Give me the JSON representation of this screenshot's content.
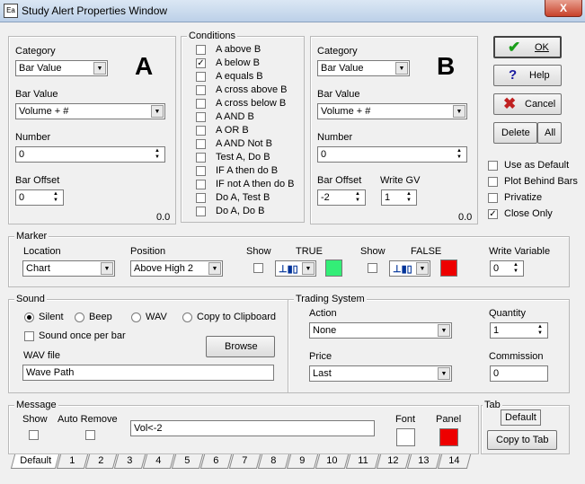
{
  "window": {
    "title": "Study Alert Properties Window",
    "close_label": "X"
  },
  "group_a": {
    "letter": "A",
    "category_label": "Category",
    "category_value": "Bar Value",
    "bar_value_label": "Bar Value",
    "bar_value_value": "Volume + #",
    "number_label": "Number",
    "number_value": "0",
    "bar_offset_label": "Bar Offset",
    "bar_offset_value": "0",
    "readout": "0.0"
  },
  "conditions": {
    "title": "Conditions",
    "items": [
      {
        "label": "A  above  B",
        "checked": false
      },
      {
        "label": "A  below  B",
        "checked": true
      },
      {
        "label": "A  equals  B",
        "checked": false
      },
      {
        "label": "A  cross above  B",
        "checked": false
      },
      {
        "label": "A  cross below  B",
        "checked": false
      },
      {
        "label": "A  AND  B",
        "checked": false
      },
      {
        "label": "A   OR   B",
        "checked": false
      },
      {
        "label": "A  AND Not  B",
        "checked": false
      },
      {
        "label": "Test A,  Do B",
        "checked": false
      },
      {
        "label": "IF A then do B",
        "checked": false
      },
      {
        "label": "IF not A then do B",
        "checked": false
      },
      {
        "label": "Do A,  Test B",
        "checked": false
      },
      {
        "label": "Do A,  Do B",
        "checked": false
      }
    ]
  },
  "group_b": {
    "letter": "B",
    "category_label": "Category",
    "category_value": "Bar Value",
    "bar_value_label": "Bar Value",
    "bar_value_value": "Volume + #",
    "number_label": "Number",
    "number_value": "0",
    "bar_offset_label": "Bar Offset",
    "bar_offset_value": "-2",
    "write_gv_label": "Write GV",
    "write_gv_value": "1",
    "readout": "0.0"
  },
  "buttons": {
    "ok": "OK",
    "help": "Help",
    "cancel": "Cancel",
    "delete": "Delete",
    "all": "All",
    "browse": "Browse",
    "copy_to_tab": "Copy to Tab",
    "default": "Default"
  },
  "options": [
    {
      "label": "Use as Default",
      "checked": false
    },
    {
      "label": "Plot Behind Bars",
      "checked": false
    },
    {
      "label": "Privatize",
      "checked": false
    },
    {
      "label": "Close Only",
      "checked": true
    }
  ],
  "marker": {
    "title": "Marker",
    "location_label": "Location",
    "location_value": "Chart",
    "position_label": "Position",
    "position_value": "Above High 2",
    "show_label_1": "Show",
    "true_label": "TRUE",
    "true_color": "#33ee77",
    "show_label_2": "Show",
    "false_label": "FALSE",
    "false_color": "#ee0000",
    "write_variable_label": "Write Variable",
    "write_variable_value": "0"
  },
  "sound": {
    "title": "Sound",
    "radios": [
      {
        "label": "Silent",
        "selected": true
      },
      {
        "label": "Beep",
        "selected": false
      },
      {
        "label": "WAV",
        "selected": false
      },
      {
        "label": "Copy to Clipboard",
        "selected": false
      }
    ],
    "once_label": "Sound once per bar",
    "wav_label": "WAV file",
    "wav_value": "Wave Path"
  },
  "trading": {
    "title": "Trading System",
    "action_label": "Action",
    "action_value": "None",
    "quantity_label": "Quantity",
    "quantity_value": "1",
    "price_label": "Price",
    "price_value": "Last",
    "commission_label": "Commission",
    "commission_value": "0"
  },
  "message": {
    "title": "Message",
    "show_label": "Show",
    "auto_remove_label": "Auto Remove",
    "text_value": "Vol<-2",
    "font_label": "Font",
    "panel_label": "Panel",
    "font_color": "#ffffff",
    "panel_color": "#ee0000"
  },
  "tab_group": {
    "title": "Tab"
  },
  "tabs": [
    "Default",
    "1",
    "2",
    "3",
    "4",
    "5",
    "6",
    "7",
    "8",
    "9",
    "10",
    "11",
    "12",
    "13",
    "14"
  ]
}
